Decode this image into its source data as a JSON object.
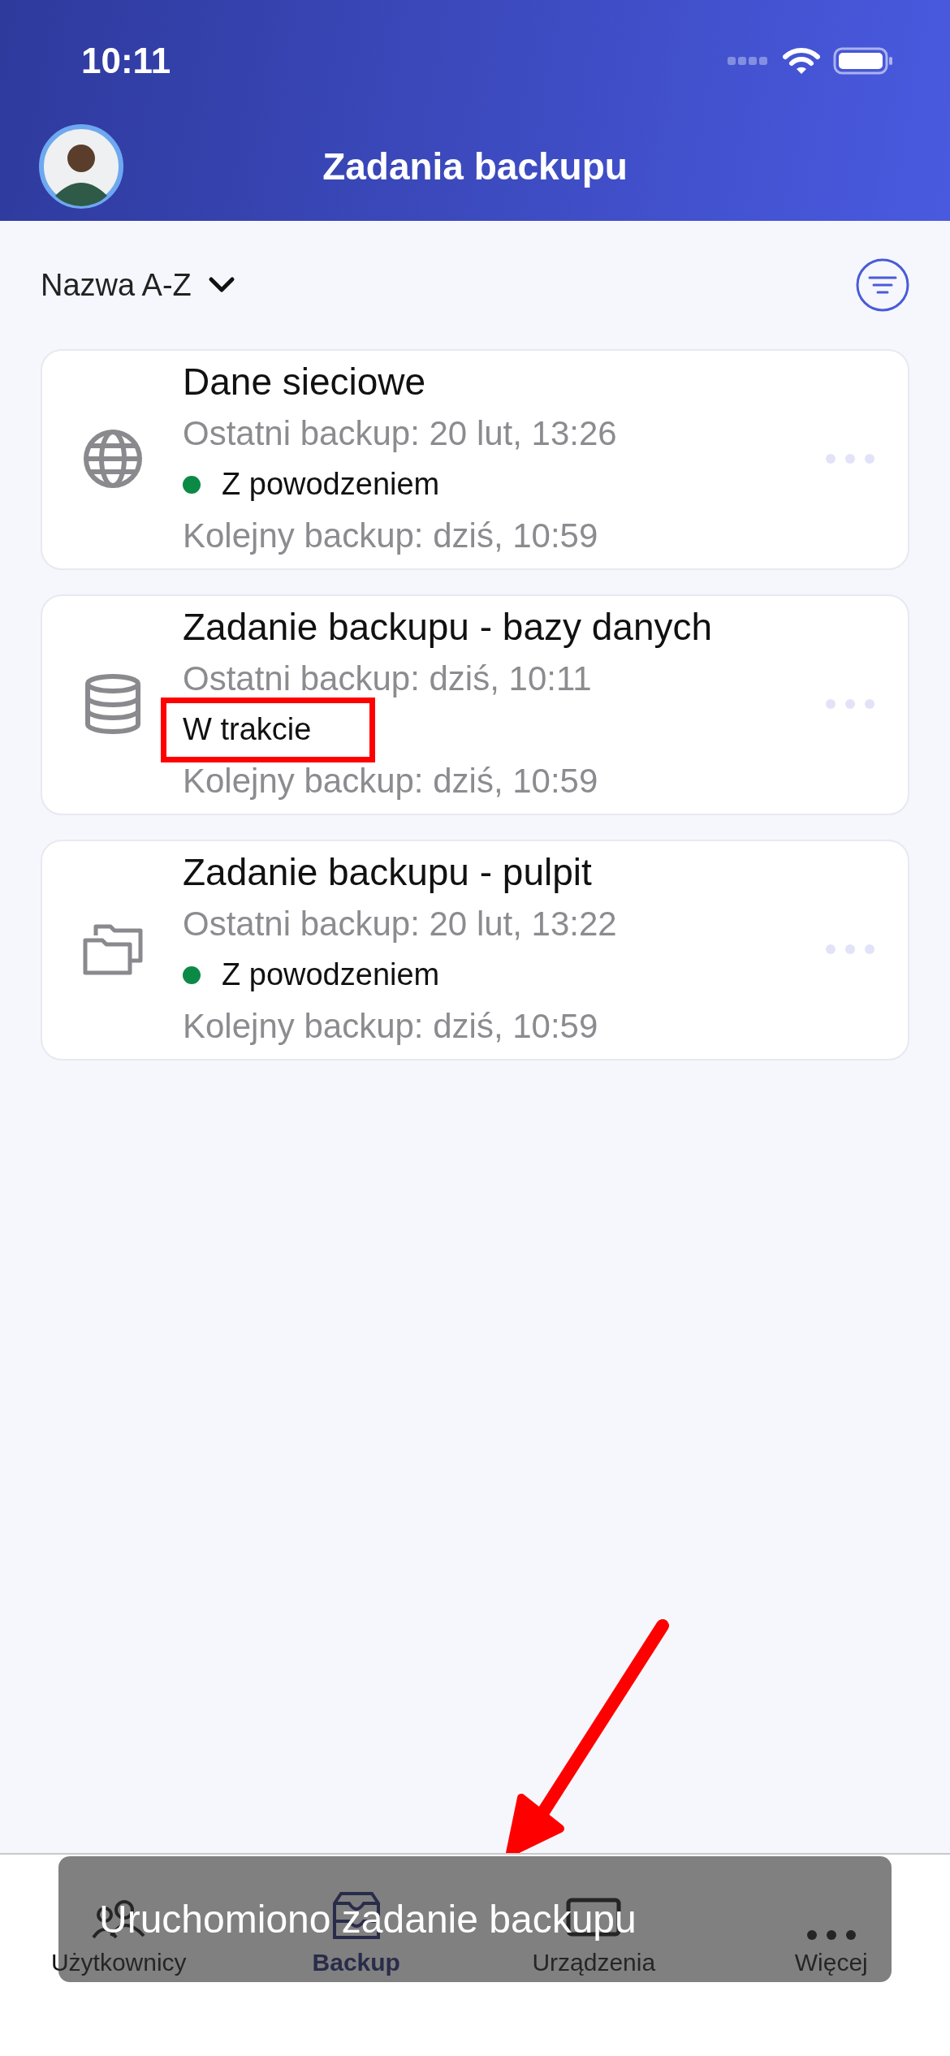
{
  "status_bar": {
    "time": "10:11"
  },
  "header": {
    "title": "Zadania backupu"
  },
  "sort": {
    "label": "Nazwa A-Z"
  },
  "jobs": [
    {
      "title": "Dane sieciowe",
      "last": "Ostatni backup: 20 lut, 13:26",
      "status": {
        "kind": "success",
        "label": "Z powodzeniem",
        "color": "#0b8a45"
      },
      "next": "Kolejny backup: dziś, 10:59",
      "highlighted": false
    },
    {
      "title": "Zadanie backupu - bazy danych",
      "last": "Ostatni backup: dziś, 10:11",
      "status": {
        "kind": "running",
        "label": "W trakcie"
      },
      "next": "Kolejny backup: dziś, 10:59",
      "highlighted": true
    },
    {
      "title": "Zadanie backupu - pulpit",
      "last": "Ostatni backup: 20 lut, 13:22",
      "status": {
        "kind": "success",
        "label": "Z powodzeniem",
        "color": "#0b8a45"
      },
      "next": "Kolejny backup: dziś, 10:59",
      "highlighted": false
    }
  ],
  "tabs": [
    {
      "label": "Użytkownicy",
      "selected": false
    },
    {
      "label": "Backup",
      "selected": true
    },
    {
      "label": "Urządzenia",
      "selected": false
    },
    {
      "label": "Więcej",
      "selected": false
    }
  ],
  "toast": {
    "message": "Uruchomiono zadanie backupu"
  }
}
